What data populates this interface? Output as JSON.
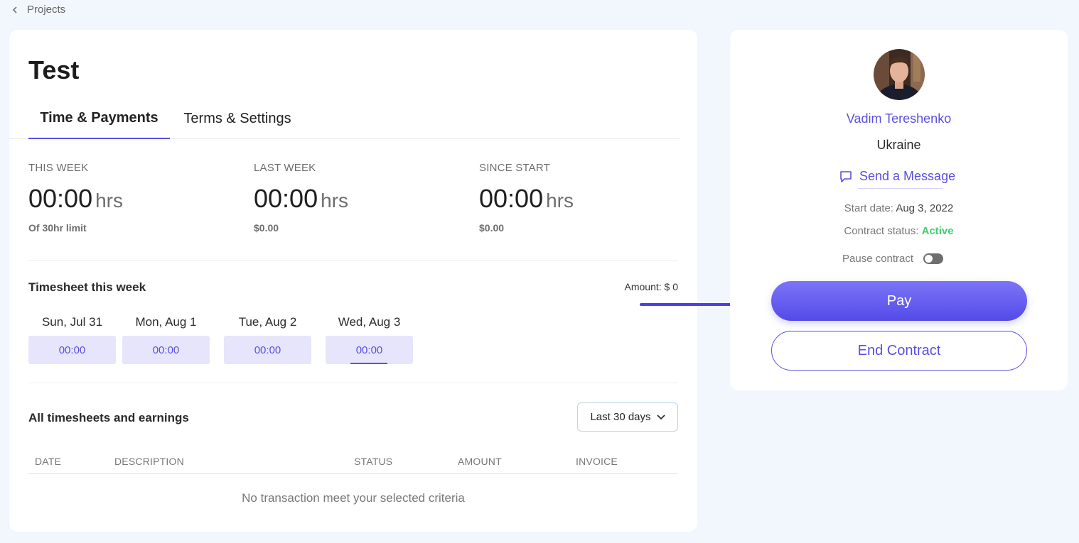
{
  "breadcrumb": {
    "label": "Projects"
  },
  "project": {
    "title": "Test"
  },
  "tabs": [
    {
      "label": "Time & Payments",
      "active": true
    },
    {
      "label": "Terms & Settings",
      "active": false
    }
  ],
  "stats": [
    {
      "label": "THIS WEEK",
      "value": "00:00",
      "unit": "hrs",
      "sub": "Of 30hr limit"
    },
    {
      "label": "LAST WEEK",
      "value": "00:00",
      "unit": "hrs",
      "sub": "$0.00"
    },
    {
      "label": "SINCE START",
      "value": "00:00",
      "unit": "hrs",
      "sub": "$0.00"
    }
  ],
  "timesheet": {
    "title": "Timesheet this week",
    "amount": "Amount: $ 0",
    "days": [
      {
        "label": "Sun, Jul 31",
        "value": "00:00"
      },
      {
        "label": "Mon, Aug 1",
        "value": "00:00"
      },
      {
        "label": "Tue, Aug 2",
        "value": "00:00"
      },
      {
        "label": "Wed, Aug 3",
        "value": "00:00"
      }
    ]
  },
  "history": {
    "title": "All timesheets and earnings",
    "period": "Last 30 days",
    "columns": [
      "DATE",
      "DESCRIPTION",
      "STATUS",
      "AMOUNT",
      "INVOICE"
    ],
    "empty": "No transaction meet your selected criteria"
  },
  "freelancer": {
    "name": "Vadim Tereshenko",
    "country": "Ukraine",
    "message_label": "Send a Message",
    "start_date_label": "Start date:",
    "start_date": "Aug 3, 2022",
    "status_label": "Contract status:",
    "status": "Active",
    "pause_label": "Pause contract",
    "pay_label": "Pay",
    "end_label": "End Contract"
  },
  "colors": {
    "accent": "#5a4fe3",
    "active_status": "#3ecf6e",
    "background": "#f2f6fd"
  },
  "icons": [
    "chevron-left-icon",
    "chevron-down-icon",
    "chat-icon",
    "arrow-right-icon"
  ]
}
